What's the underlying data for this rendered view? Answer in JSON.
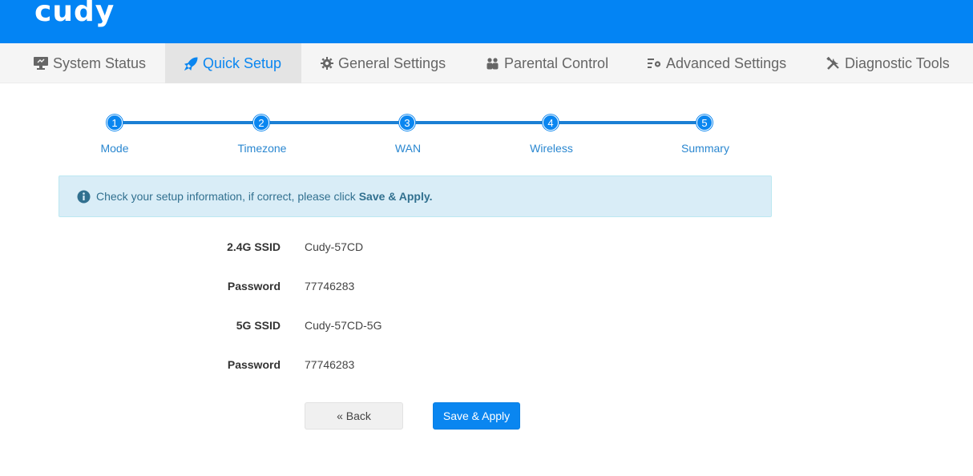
{
  "brand": {
    "logo_text": "cudy",
    "header_color": "#0384f4"
  },
  "nav": {
    "items": [
      {
        "label": "System Status",
        "icon": "monitor-icon",
        "active": false
      },
      {
        "label": "Quick Setup",
        "icon": "rocket-icon",
        "active": true
      },
      {
        "label": "General Settings",
        "icon": "gear-icon",
        "active": false
      },
      {
        "label": "Parental Control",
        "icon": "users-icon",
        "active": false
      },
      {
        "label": "Advanced Settings",
        "icon": "settings-list-icon",
        "active": false
      },
      {
        "label": "Diagnostic Tools",
        "icon": "tools-icon",
        "active": false
      }
    ]
  },
  "stepper": {
    "steps": [
      {
        "number": "1",
        "label": "Mode"
      },
      {
        "number": "2",
        "label": "Timezone"
      },
      {
        "number": "3",
        "label": "WAN"
      },
      {
        "number": "4",
        "label": "Wireless"
      },
      {
        "number": "5",
        "label": "Summary"
      }
    ],
    "current_step": 5
  },
  "alert": {
    "icon": "info-circle-icon",
    "text": "Check your setup information, if correct, please click",
    "emphasis": "Save & Apply."
  },
  "summary": {
    "rows": [
      {
        "label": "2.4G SSID",
        "value": "Cudy-57CD"
      },
      {
        "label": "Password",
        "value": "77746283"
      },
      {
        "label": "5G SSID",
        "value": "Cudy-57CD-5G"
      },
      {
        "label": "Password",
        "value": "77746283"
      }
    ]
  },
  "buttons": {
    "back_label": "« Back",
    "apply_label": "Save & Apply"
  },
  "colors": {
    "accent": "#0a86f0",
    "alert_bg": "#d9edf7",
    "alert_text": "#31708f"
  }
}
